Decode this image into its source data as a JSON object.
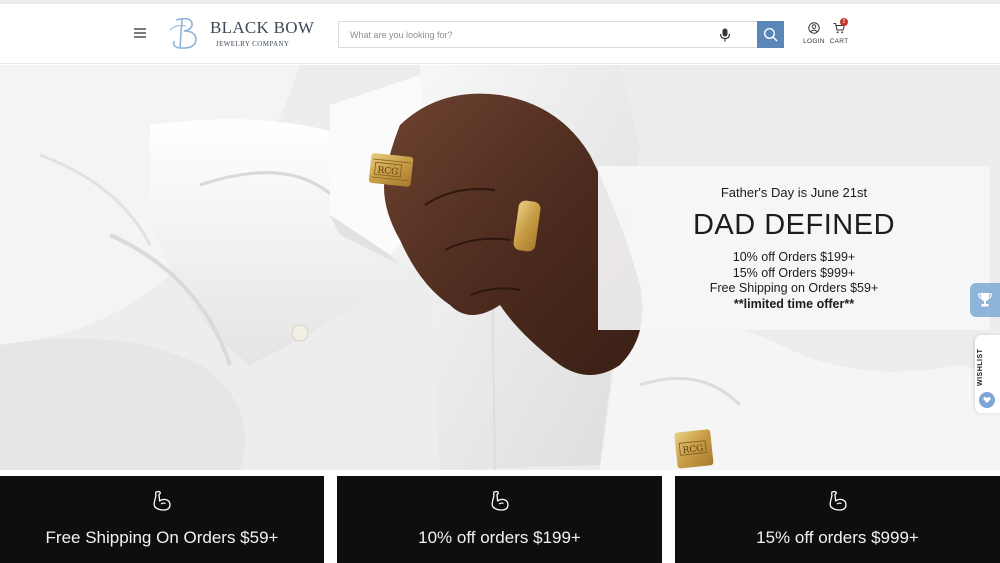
{
  "header": {
    "brand_name": "BLACK BOW",
    "brand_sub": "JEWELRY COMPANY",
    "search_placeholder": "What are you looking for?",
    "login_label": "LOGIN",
    "cart_label": "CART",
    "cart_count": "2"
  },
  "hero": {
    "eyebrow": "Father's Day is June 21st",
    "headline": "DAD DEFINED",
    "offers": [
      "10% off Orders $199+",
      "15% off Orders $999+",
      "Free Shipping on Orders $59+"
    ],
    "limited": "**limited time offer**",
    "cufflink_engraving": "RCG"
  },
  "side_tabs": {
    "wishlist_label": "WISHLIST"
  },
  "tiles": [
    {
      "text": "Free Shipping On Orders $59+",
      "icon": "flexed-arm-icon"
    },
    {
      "text": "10% off orders $199+",
      "icon": "flexed-arm-icon"
    },
    {
      "text": "15% off orders $999+",
      "icon": "flexed-arm-icon"
    }
  ],
  "colors": {
    "search_button": "#5a87b8",
    "cart_badge": "#c8322c",
    "tile_background": "#0e0e0e",
    "trophy_tab": "#8fb4da"
  }
}
